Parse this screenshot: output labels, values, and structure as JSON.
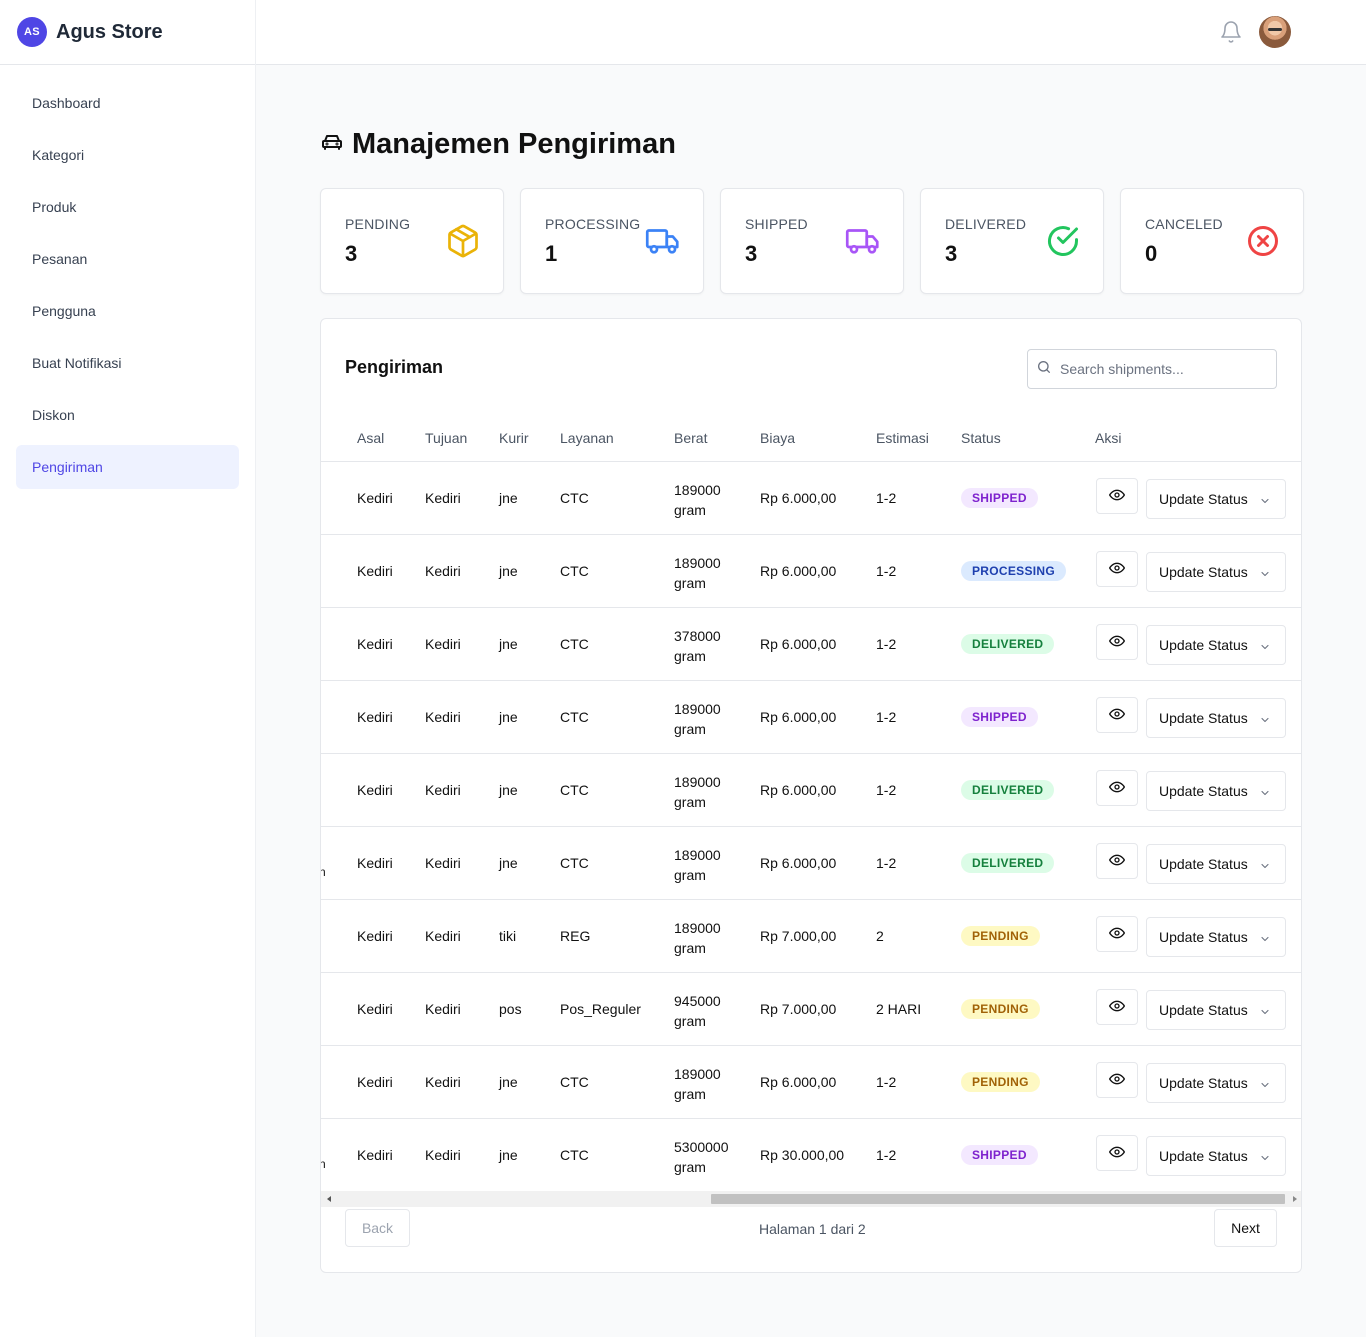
{
  "brand": {
    "logo_text": "AS",
    "name": "Agus Store"
  },
  "sidebar": {
    "items": [
      {
        "label": "Dashboard",
        "active": false
      },
      {
        "label": "Kategori",
        "active": false
      },
      {
        "label": "Produk",
        "active": false
      },
      {
        "label": "Pesanan",
        "active": false
      },
      {
        "label": "Pengguna",
        "active": false
      },
      {
        "label": "Buat Notifikasi",
        "active": false
      },
      {
        "label": "Diskon",
        "active": false
      },
      {
        "label": "Pengiriman",
        "active": true
      }
    ]
  },
  "header": {
    "icons": [
      "bell-icon",
      "avatar"
    ]
  },
  "page": {
    "title": "Manajemen Pengiriman",
    "title_icon": "car-icon"
  },
  "stats": [
    {
      "label": "PENDING",
      "value": "3",
      "icon": "package-icon",
      "color": "#eab308"
    },
    {
      "label": "PROCESSING",
      "value": "1",
      "icon": "truck-icon",
      "color": "#3b82f6"
    },
    {
      "label": "SHIPPED",
      "value": "3",
      "icon": "truck-icon",
      "color": "#a855f7"
    },
    {
      "label": "DELIVERED",
      "value": "3",
      "icon": "check-circle-icon",
      "color": "#22c55e"
    },
    {
      "label": "CANCELED",
      "value": "0",
      "icon": "x-circle-icon",
      "color": "#ef4444"
    }
  ],
  "table": {
    "title": "Pengiriman",
    "search_placeholder": "Search shipments...",
    "columns": [
      "Asal",
      "Tujuan",
      "Kurir",
      "Layanan",
      "Berat",
      "Biaya",
      "Estimasi",
      "Status",
      "Aksi"
    ],
    "action_label": "Update Status",
    "rows": [
      {
        "asal": "Kediri",
        "tujuan": "Kediri",
        "kurir": "jne",
        "layanan": "CTC",
        "berat": "189000 gram",
        "biaya": "Rp 6.000,00",
        "estimasi": "1-2",
        "status": "SHIPPED",
        "edge": ""
      },
      {
        "asal": "Kediri",
        "tujuan": "Kediri",
        "kurir": "jne",
        "layanan": "CTC",
        "berat": "189000 gram",
        "biaya": "Rp 6.000,00",
        "estimasi": "1-2",
        "status": "PROCESSING",
        "edge": ""
      },
      {
        "asal": "Kediri",
        "tujuan": "Kediri",
        "kurir": "jne",
        "layanan": "CTC",
        "berat": "378000 gram",
        "biaya": "Rp 6.000,00",
        "estimasi": "1-2",
        "status": "DELIVERED",
        "edge": ""
      },
      {
        "asal": "Kediri",
        "tujuan": "Kediri",
        "kurir": "jne",
        "layanan": "CTC",
        "berat": "189000 gram",
        "biaya": "Rp 6.000,00",
        "estimasi": "1-2",
        "status": "SHIPPED",
        "edge": ""
      },
      {
        "asal": "Kediri",
        "tujuan": "Kediri",
        "kurir": "jne",
        "layanan": "CTC",
        "berat": "189000 gram",
        "biaya": "Rp 6.000,00",
        "estimasi": "1-2",
        "status": "DELIVERED",
        "edge": ""
      },
      {
        "asal": "Kediri",
        "tujuan": "Kediri",
        "kurir": "jne",
        "layanan": "CTC",
        "berat": "189000 gram",
        "biaya": "Rp 6.000,00",
        "estimasi": "1-2",
        "status": "DELIVERED",
        "edge": "n"
      },
      {
        "asal": "Kediri",
        "tujuan": "Kediri",
        "kurir": "tiki",
        "layanan": "REG",
        "berat": "189000 gram",
        "biaya": "Rp 7.000,00",
        "estimasi": "2",
        "status": "PENDING",
        "edge": ""
      },
      {
        "asal": "Kediri",
        "tujuan": "Kediri",
        "kurir": "pos",
        "layanan": "Pos_Reguler",
        "berat": "945000 gram",
        "biaya": "Rp 7.000,00",
        "estimasi": "2 HARI",
        "status": "PENDING",
        "edge": ""
      },
      {
        "asal": "Kediri",
        "tujuan": "Kediri",
        "kurir": "jne",
        "layanan": "CTC",
        "berat": "189000 gram",
        "biaya": "Rp 6.000,00",
        "estimasi": "1-2",
        "status": "PENDING",
        "edge": ""
      },
      {
        "asal": "Kediri",
        "tujuan": "Kediri",
        "kurir": "jne",
        "layanan": "CTC",
        "berat": "5300000 gram",
        "biaya": "Rp 30.000,00",
        "estimasi": "1-2",
        "status": "SHIPPED",
        "edge": "n"
      }
    ]
  },
  "pagination": {
    "back_label": "Back",
    "page_text": "Halaman 1 dari 2",
    "next_label": "Next"
  },
  "colors": {
    "accent": "#4f46e5",
    "active_nav_bg": "#eef2ff"
  }
}
